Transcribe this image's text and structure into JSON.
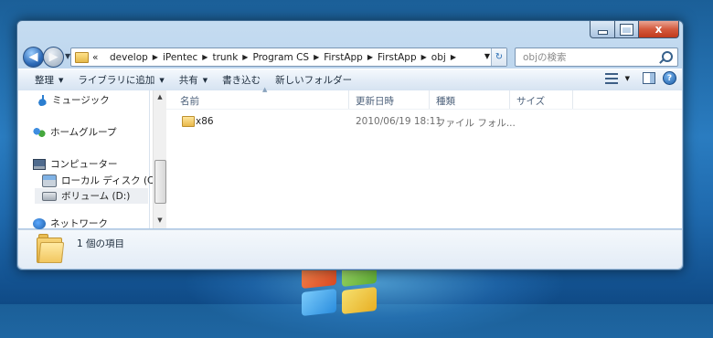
{
  "window": {
    "caption": {
      "minimize": "",
      "maximize": "",
      "close": "x"
    }
  },
  "address_bar": {
    "overflow": "«",
    "crumbs": [
      "develop",
      "iPentec",
      "trunk",
      "Program CS",
      "FirstApp",
      "FirstApp",
      "obj"
    ]
  },
  "search": {
    "placeholder": "objの検索"
  },
  "toolbar": {
    "organize": "整理",
    "add_to_library": "ライブラリに追加",
    "share": "共有",
    "burn": "書き込む",
    "new_folder": "新しいフォルダー"
  },
  "nav_pane": {
    "music": "ミュージック",
    "homegroup": "ホームグループ",
    "computer": "コンピューター",
    "local_disk": "ローカル ディスク (C:",
    "volume_d": "ボリューム (D:)",
    "network": "ネットワーク"
  },
  "columns": {
    "name": "名前",
    "modified": "更新日時",
    "type": "種類",
    "size": "サイズ"
  },
  "files": [
    {
      "name": "x86",
      "modified": "2010/06/19 18:11",
      "type": "ファイル フォル..."
    }
  ],
  "details": {
    "status": "1 個の項目"
  }
}
